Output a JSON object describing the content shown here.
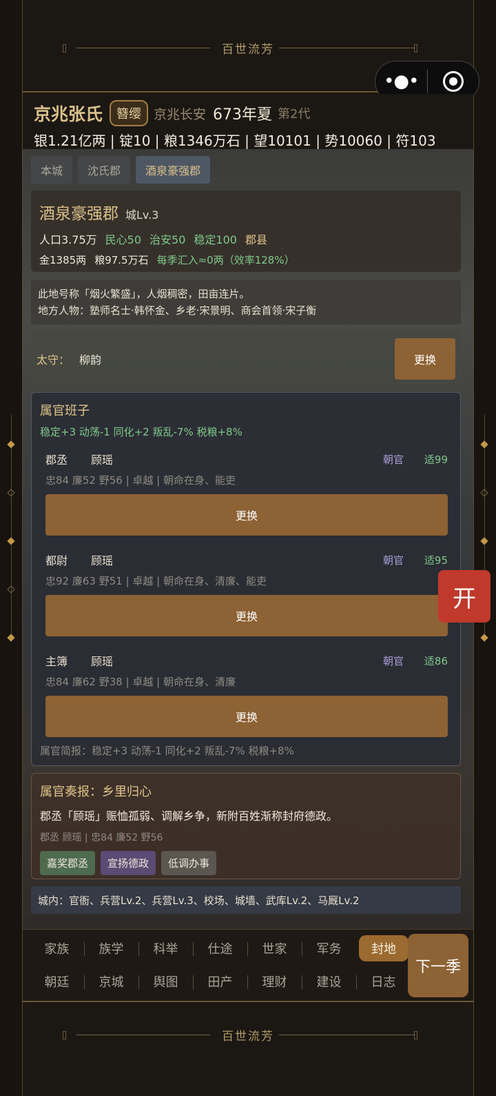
{
  "banner": {
    "title": "百世流芳"
  },
  "capsule": {
    "menu_icon": "more-dots-icon",
    "close_icon": "record-circle-icon"
  },
  "header": {
    "clan": "京兆张氏",
    "rank": "簪缨",
    "location": "京兆长安",
    "year": "673年夏",
    "generation": "第2代",
    "resources": "银1.21亿两 | 锭10 | 粮1346万石 | 望10101 | 势10060 | 符103"
  },
  "tabs": [
    "本城",
    "沈氏郡",
    "酒泉豪强郡"
  ],
  "city": {
    "name": "酒泉豪强郡",
    "level": "城Lv.3",
    "population": "人口3.75万",
    "morale": "民心50",
    "order": "治安50",
    "stability": "稳定100",
    "type": "郡县",
    "gold": "金1385两",
    "grain": "粮97.5万石",
    "income": "每季汇入≈0两（效率128%）"
  },
  "description": {
    "line1": "此地号称「烟火繁盛」，人烟稠密，田亩连片。",
    "line2": "地方人物：塾师名士·韩怀金、乡老·宋景明、商会首领·宋子衡"
  },
  "governor": {
    "label": "太守：",
    "name": "柳韵",
    "button": "更换"
  },
  "officials": {
    "title": "属官班子",
    "effects": "稳定+3  动荡-1  同化+2  叛乱-7%  税粮+8%",
    "list": [
      {
        "position": "郡丞",
        "name": "顾瑶",
        "tag": "朝官",
        "fit": "适99",
        "stats": "忠84 廉52 野56 | 卓越 | 朝命在身、能吏",
        "button": "更换"
      },
      {
        "position": "都尉",
        "name": "顾瑶",
        "tag": "朝官",
        "fit": "适95",
        "stats": "忠92 廉63 野51 | 卓越 | 朝命在身、清廉、能吏",
        "button": "更换"
      },
      {
        "position": "主簿",
        "name": "顾瑶",
        "tag": "朝官",
        "fit": "适86",
        "stats": "忠84 廉62 野38 | 卓越 | 朝命在身、清廉",
        "button": "更换"
      }
    ],
    "brief": "属官简报：稳定+3  动荡-1  同化+2  叛乱-7%  税粮+8%"
  },
  "report": {
    "title": "属官奏报：乡里归心",
    "body": "郡丞「顾瑶」赈恤孤弱、调解乡争，新附百姓渐称封府德政。",
    "meta": "郡丞 顾瑶 | 忠84 廉52 野56",
    "actions": [
      "嘉奖郡丞",
      "宣扬德政",
      "低调办事"
    ]
  },
  "buildings": "城内：官衙、兵营Lv.2、兵营Lv.3、校场、城墙、武库Lv.2、马厩Lv.2",
  "nav": {
    "row1": [
      "家族",
      "族学",
      "科举",
      "仕途",
      "世家",
      "军务",
      "封地"
    ],
    "row2": [
      "朝廷",
      "京城",
      "舆图",
      "田产",
      "理财",
      "建设",
      "日志"
    ],
    "active": "封地",
    "next": "下一季"
  },
  "float_button": "开"
}
